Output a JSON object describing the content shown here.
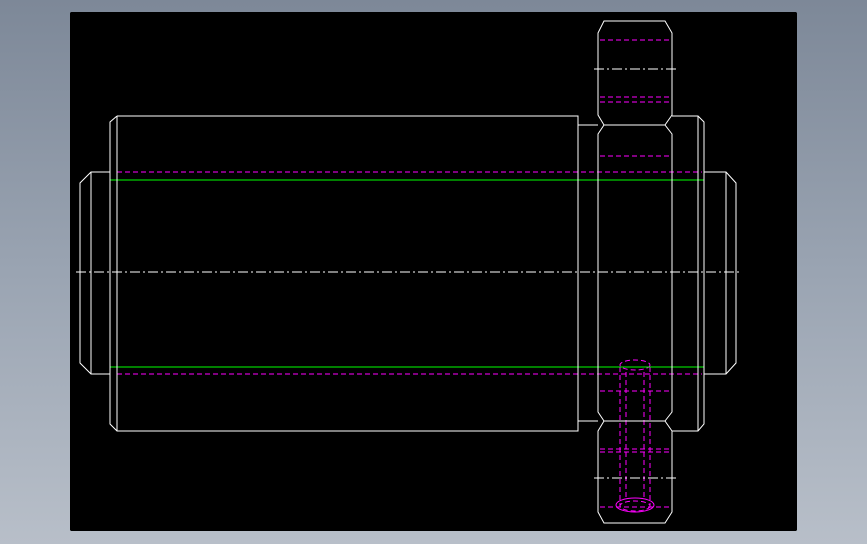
{
  "viewport": {
    "background": "#000000"
  },
  "colors": {
    "outline": "#ffffff",
    "hidden_lines": "#ff00ff",
    "thread_lines": "#00ff00",
    "center_lines": "#ffffff"
  },
  "line_styles": {
    "outline": "solid",
    "hidden_lines": "dashed",
    "thread_lines": "solid",
    "center_lines": "dash-dot"
  },
  "drawing": {
    "view": "front",
    "parts": [
      "shaft",
      "gear",
      "bore-hole"
    ]
  }
}
